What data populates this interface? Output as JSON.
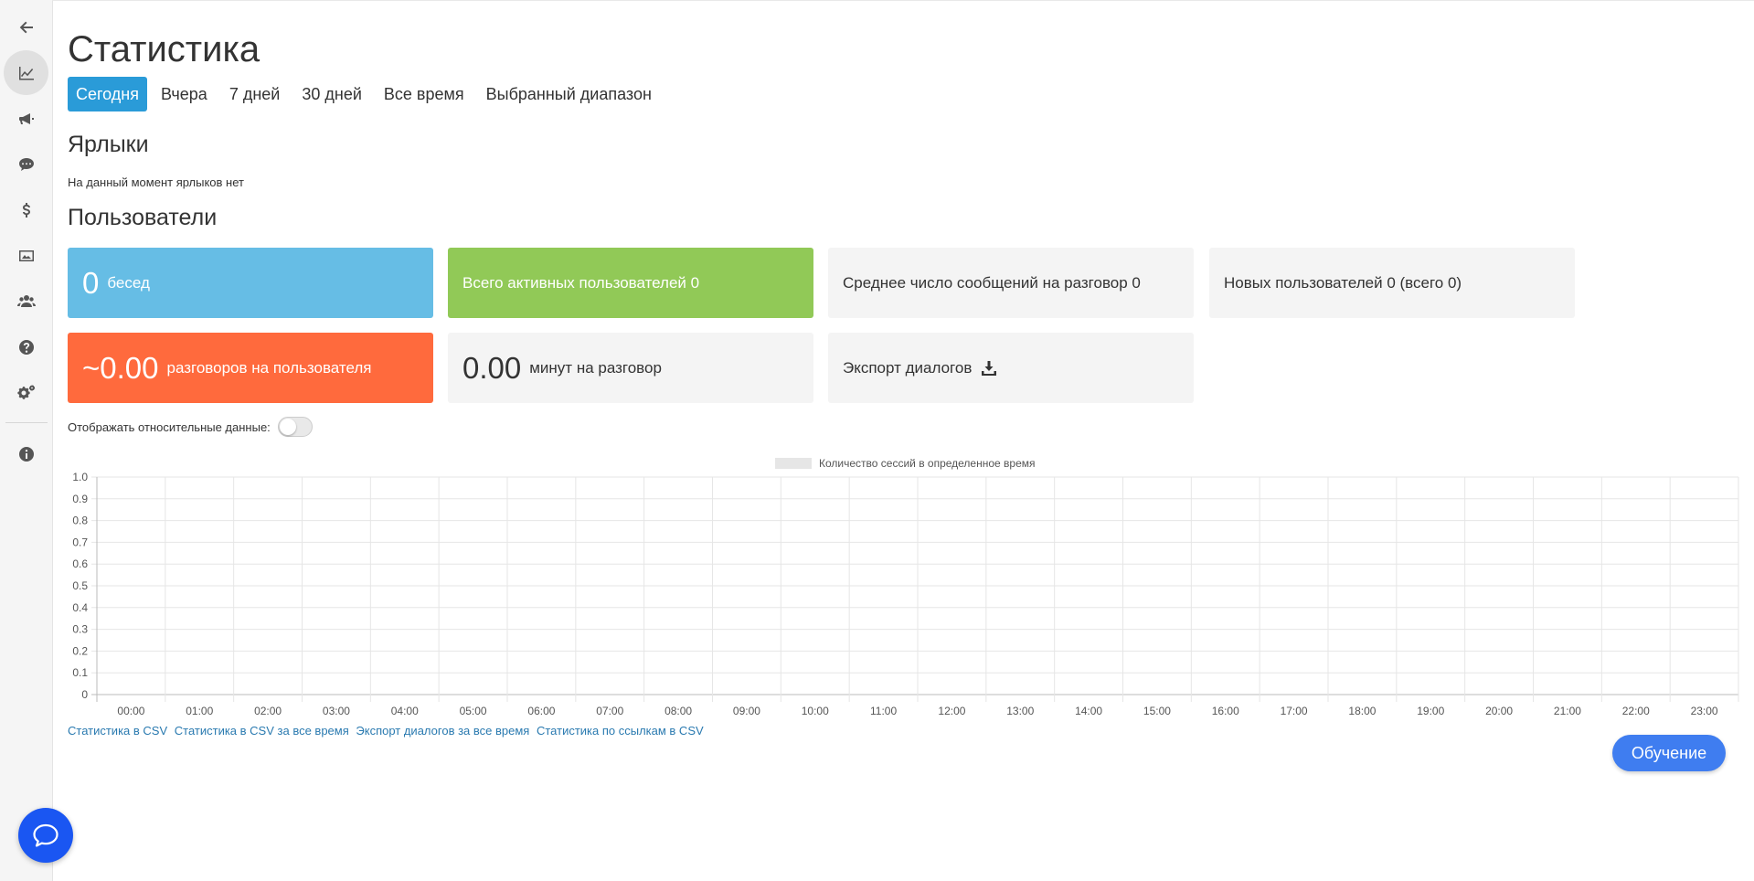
{
  "page": {
    "title": "Статистика"
  },
  "tabs": [
    {
      "label": "Сегодня",
      "active": true
    },
    {
      "label": "Вчера",
      "active": false
    },
    {
      "label": "7 дней",
      "active": false
    },
    {
      "label": "30 дней",
      "active": false
    },
    {
      "label": "Все время",
      "active": false
    },
    {
      "label": "Выбранный диапазон",
      "active": false
    }
  ],
  "labels_section": {
    "heading": "Ярлыки",
    "empty_note": "На данный момент ярлыков нет"
  },
  "users_section": {
    "heading": "Пользователи",
    "cards": {
      "conversations": {
        "value": "0",
        "label": "бесед",
        "color": "#66bde5"
      },
      "active_users": {
        "label": "Всего активных пользователей 0",
        "color": "#91c957"
      },
      "avg_messages": {
        "label": "Среднее число сообщений на разговор 0"
      },
      "new_users": {
        "label": "Новых пользователей 0 (всего 0)"
      },
      "per_user": {
        "value": "~0.00",
        "label": "разговоров на пользователя",
        "color": "#ff6a3d"
      },
      "minutes": {
        "value": "0.00",
        "label": "минут на разговор"
      },
      "export": {
        "label": "Экспорт диалогов",
        "icon": "download-icon"
      }
    }
  },
  "relative_toggle": {
    "label": "Отображать относительные данные:",
    "on": false
  },
  "chart_data": {
    "type": "bar",
    "legend": [
      "Количество сессий в определенное время"
    ],
    "legend_position": "top-center",
    "categories": [
      "00:00",
      "01:00",
      "02:00",
      "03:00",
      "04:00",
      "05:00",
      "06:00",
      "07:00",
      "08:00",
      "09:00",
      "10:00",
      "11:00",
      "12:00",
      "13:00",
      "14:00",
      "15:00",
      "16:00",
      "17:00",
      "18:00",
      "19:00",
      "20:00",
      "21:00",
      "22:00",
      "23:00"
    ],
    "series": [
      {
        "name": "Количество сессий в определенное время",
        "values": [
          0,
          0,
          0,
          0,
          0,
          0,
          0,
          0,
          0,
          0,
          0,
          0,
          0,
          0,
          0,
          0,
          0,
          0,
          0,
          0,
          0,
          0,
          0,
          0
        ]
      }
    ],
    "ylim": [
      0,
      1.0
    ],
    "yticks": [
      "0",
      "0.1",
      "0.2",
      "0.3",
      "0.4",
      "0.5",
      "0.6",
      "0.7",
      "0.8",
      "0.9",
      "1.0"
    ],
    "grid": true
  },
  "footer_links": [
    "Статистика в CSV",
    "Статистика в CSV за все время",
    "Экспорт диалогов за все время",
    "Статистика по ссылкам в CSV"
  ],
  "learn_button": "Обучение",
  "sidebar": {
    "items": [
      "back-arrow-icon",
      "line-chart-icon",
      "megaphone-icon",
      "chat-icon",
      "dollar-icon",
      "gallery-icon",
      "users-icon",
      "help-icon",
      "settings-icon",
      "info-icon"
    ],
    "active": "line-chart-icon"
  },
  "colors": {
    "accent": "#2a9bd8",
    "chat_widget": "#1a56f2",
    "learn_button": "#3f7df0",
    "link": "#2a7ab0"
  }
}
